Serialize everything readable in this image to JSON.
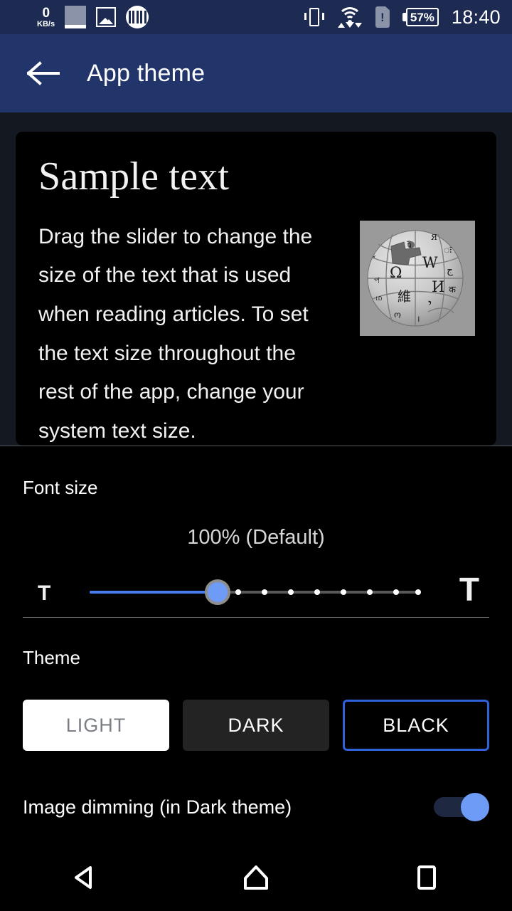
{
  "status_bar": {
    "net_speed_value": "0",
    "net_speed_unit": "KB/s",
    "icons": [
      "screenshot-icon",
      "image-icon",
      "barcode-icon",
      "vibrate-icon",
      "wifi-icon",
      "sim-alert-icon"
    ],
    "battery_percent": "57%",
    "clock": "18:40",
    "background_color": "#1d2a52"
  },
  "app_bar": {
    "back_icon": "arrow-left-icon",
    "title": "App theme",
    "background_color": "#22356b"
  },
  "preview": {
    "sample_title": "Sample text",
    "sample_body": "Drag the slider to change the size of the text that is used when reading articles. To set the text size throughout the rest of the app, change your system text size.",
    "image_name": "wikipedia-globe-logo",
    "card_background_color": "#000000"
  },
  "font_size": {
    "label": "Font size",
    "value_text": "100% (Default)",
    "small_t": "T",
    "large_t": "T",
    "slider": {
      "accent_color": "#4a7cf0",
      "track_color": "#585858",
      "tick_count": 8,
      "position_percent": 35
    }
  },
  "theme": {
    "label": "Theme",
    "options": [
      {
        "label": "LIGHT",
        "selected": false
      },
      {
        "label": "DARK",
        "selected": false
      },
      {
        "label": "BLACK",
        "selected": true
      }
    ],
    "selected_border_color": "#2f62d8"
  },
  "image_dimming": {
    "label": "Image dimming (in Dark theme)",
    "enabled": true,
    "accent_color": "#6e9bf5"
  },
  "nav_bar": {
    "back": "triangle-back-icon",
    "home": "home-pentagon-icon",
    "recents": "square-recents-icon"
  }
}
